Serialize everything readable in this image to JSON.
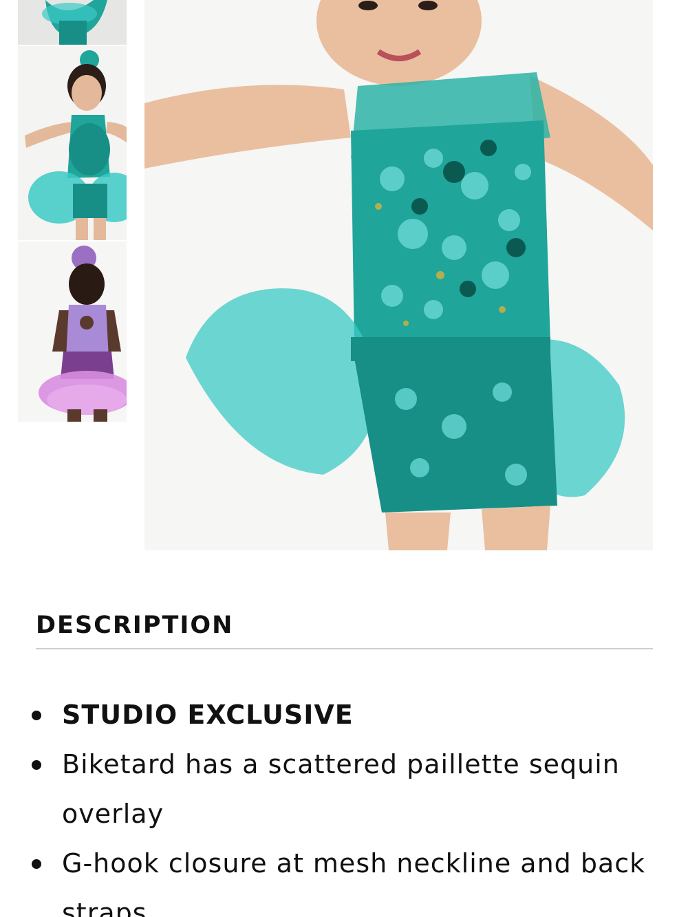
{
  "gallery": {
    "thumbnails": [
      {
        "icon": "costume-thumbnail-teal-partial"
      },
      {
        "icon": "costume-thumbnail-teal-front"
      },
      {
        "icon": "costume-thumbnail-purple-back"
      }
    ],
    "main_image": {
      "icon": "costume-photo-teal-sequin-biketard"
    }
  },
  "description": {
    "heading": "DESCRIPTION",
    "items": [
      "STUDIO EXCLUSIVE",
      "Biketard has a scattered paillette sequin overlay",
      "G-hook closure at mesh neckline and back straps"
    ]
  },
  "colors": {
    "teal": "#1fa59a",
    "aqua_tulle": "#3cc9c6",
    "purple": "#9a6fc4",
    "pink_tulle": "#d98ee0",
    "text": "#111111",
    "divider": "#cfcfcf"
  }
}
